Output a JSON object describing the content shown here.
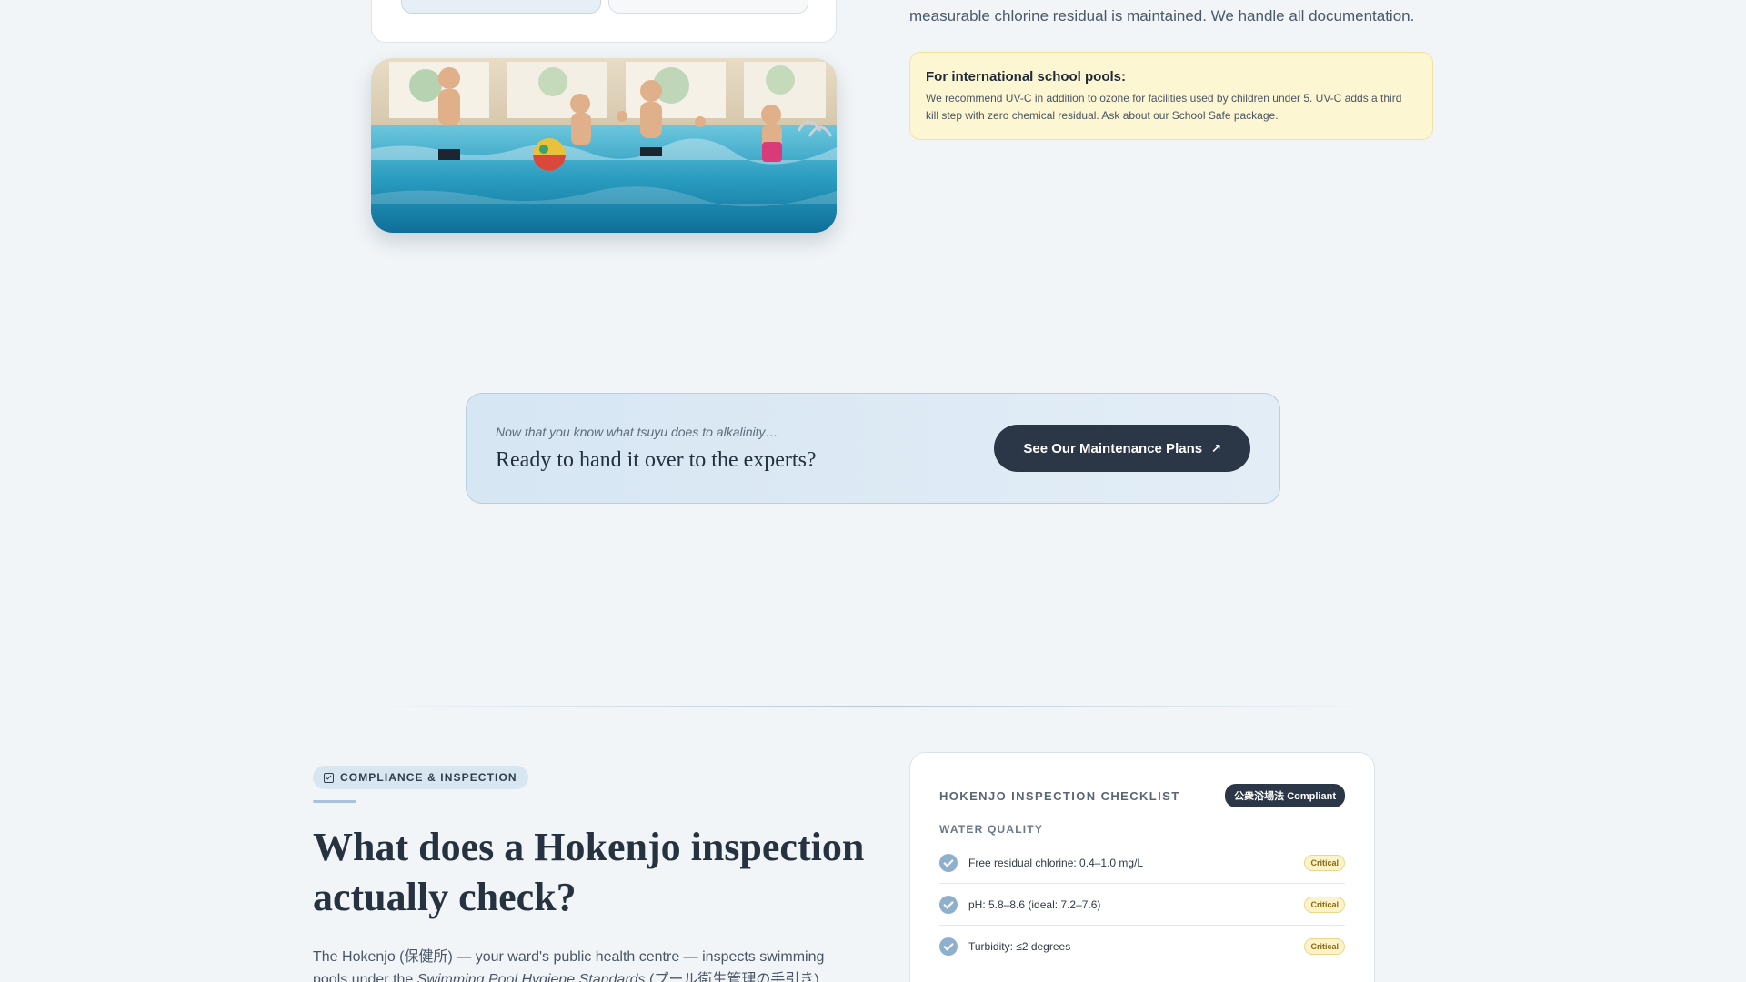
{
  "top": {
    "text": "measurable chlorine residual is maintained. We handle all documentation."
  },
  "note": {
    "title": "For international school pools:",
    "body": "We recommend UV-C in addition to ozone for facilities used by children under 5. UV-C adds a third kill step with zero chemical residual. Ask about our School Safe package."
  },
  "cta": {
    "kicker": "Now that you know what tsuyu does to alkalinity…",
    "heading": "Ready to hand it over to the experts?",
    "button_label": "See Our Maintenance Plans",
    "button_icon": "arrow-up-right-icon"
  },
  "compliance": {
    "tag": "COMPLIANCE & INSPECTION",
    "title": "What does a Hokenjo inspection actually check?",
    "body_line1": "The Hokenjo (保健所) — your ward's public health centre — inspects swimming",
    "body_line2_pre": "pools under the ",
    "body_line2_em": "Swimming Pool Hygiene Standards",
    "body_line2_post": " (プール衛生管理の手引き)."
  },
  "checklist": {
    "title": "HOKENJO INSPECTION CHECKLIST",
    "badge": "公衆浴場法 Compliant",
    "group": "WATER QUALITY",
    "items": [
      {
        "text": "Free residual chlorine: 0.4–1.0 mg/L",
        "badge": "Critical"
      },
      {
        "text": "pH: 5.8–8.6 (ideal: 7.2–7.6)",
        "badge": "Critical"
      },
      {
        "text": "Turbidity: ≤2 degrees",
        "badge": "Critical"
      }
    ]
  },
  "colors": {
    "accent_dark": "#2b3746",
    "note_bg": "#fdf6d3",
    "check": "#8fb0cc"
  }
}
